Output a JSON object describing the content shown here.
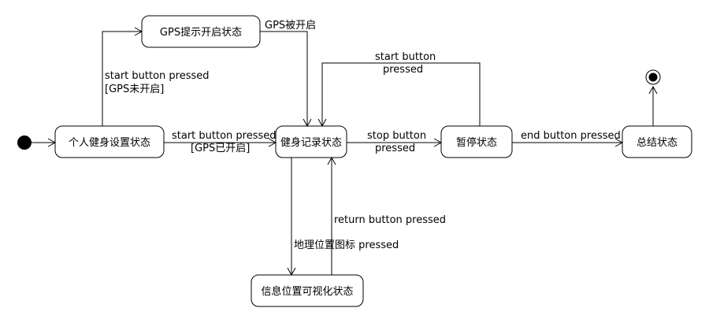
{
  "states": {
    "personal_settings": "个人健身设置状态",
    "gps_prompt": "GPS提示开启状态",
    "fitness_record": "健身记录状态",
    "paused": "暂停状态",
    "summary": "总结状态",
    "location_visual": "信息位置可视化状态"
  },
  "transitions": {
    "start_gps_off": [
      "start button pressed",
      "[GPS未开启]"
    ],
    "gps_enabled": [
      "GPS被开启"
    ],
    "start_gps_on": [
      "start button pressed",
      "[GPS已开启]"
    ],
    "stop": [
      "stop button",
      "pressed"
    ],
    "resume": [
      "start button",
      "pressed"
    ],
    "end": [
      "end button pressed"
    ],
    "map_icon": [
      "地理位置图标 pressed"
    ],
    "return": [
      "return button pressed"
    ]
  }
}
